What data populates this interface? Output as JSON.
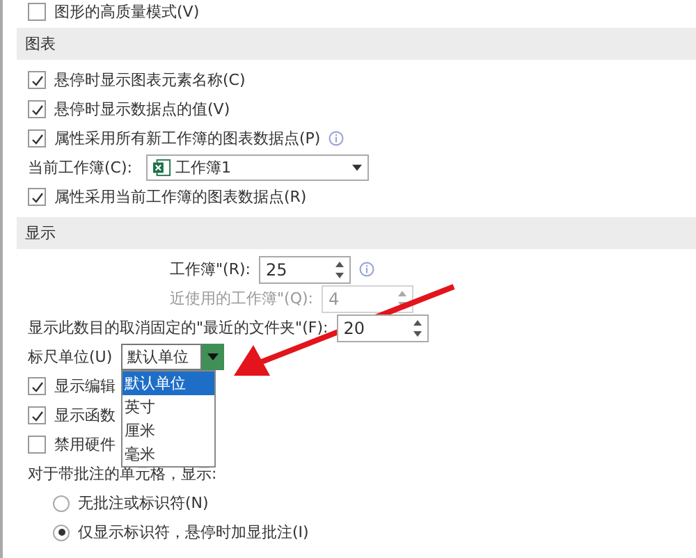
{
  "top_option": {
    "label": "图形的高质量模式(V)",
    "checked": false
  },
  "chart_section": {
    "title": "图表",
    "items": [
      {
        "kind": "checkbox",
        "label": "悬停时显示图表元素名称(C)",
        "checked": true,
        "info": false
      },
      {
        "kind": "checkbox",
        "label": "悬停时显示数据点的值(V)",
        "checked": true,
        "info": false
      },
      {
        "kind": "checkbox",
        "label": "属性采用所有新工作簿的图表数据点(P)",
        "checked": true,
        "info": true
      },
      {
        "kind": "select",
        "label": "当前工作簿(C):",
        "value": "工作簿1"
      },
      {
        "kind": "checkbox",
        "label": "属性采用当前工作簿的图表数据点(R)",
        "checked": true,
        "info": false
      }
    ]
  },
  "display_section": {
    "title": "显示",
    "items": [
      {
        "kind": "spin",
        "label": "工作簿\"(R):",
        "value": "25",
        "disabled": false,
        "info": true,
        "indent": true
      },
      {
        "kind": "spin",
        "label": "近使用的工作簿\"(Q):",
        "value": "4",
        "disabled": true,
        "info": false,
        "indent": true
      },
      {
        "kind": "spin",
        "label": "显示此数目的取消固定的\"最近的文件夹\"(F):",
        "value": "20",
        "disabled": false,
        "info": false,
        "indent": false
      },
      {
        "kind": "dropdown",
        "label": "标尺单位(U)",
        "value": "默认单位",
        "options": [
          {
            "label": "默认单位",
            "selected": true
          },
          {
            "label": "英寸",
            "selected": false
          },
          {
            "label": "厘米",
            "selected": false
          },
          {
            "label": "毫米",
            "selected": false
          }
        ]
      },
      {
        "kind": "checkbox",
        "label": "显示编辑",
        "checked": true
      },
      {
        "kind": "checkbox",
        "label": "显示函数",
        "checked": true
      },
      {
        "kind": "checkbox",
        "label": "禁用硬件",
        "checked": false
      },
      {
        "kind": "text",
        "label": "对于带批注的单元格，显示:"
      },
      {
        "kind": "radio",
        "label": "无批注或标识符(N)",
        "selected": false
      },
      {
        "kind": "radio",
        "label": "仅显示标识符，悬停时加显批注(I)",
        "selected": true
      }
    ]
  }
}
